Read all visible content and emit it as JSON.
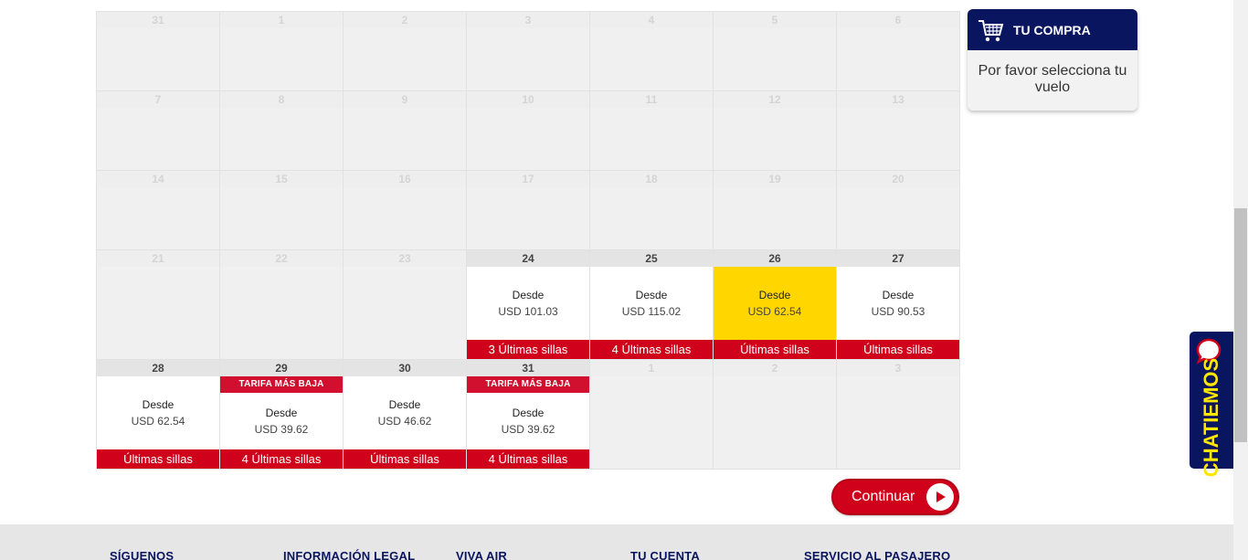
{
  "calendar": {
    "rows": [
      {
        "size": "s",
        "cells": [
          {
            "day": "31",
            "active": false
          },
          {
            "day": "1",
            "active": false
          },
          {
            "day": "2",
            "active": false
          },
          {
            "day": "3",
            "active": false
          },
          {
            "day": "4",
            "active": false
          },
          {
            "day": "5",
            "active": false
          },
          {
            "day": "6",
            "active": false
          }
        ]
      },
      {
        "size": "s",
        "cells": [
          {
            "day": "7",
            "active": false
          },
          {
            "day": "8",
            "active": false
          },
          {
            "day": "9",
            "active": false
          },
          {
            "day": "10",
            "active": false
          },
          {
            "day": "11",
            "active": false
          },
          {
            "day": "12",
            "active": false
          },
          {
            "day": "13",
            "active": false
          }
        ]
      },
      {
        "size": "s",
        "cells": [
          {
            "day": "14",
            "active": false
          },
          {
            "day": "15",
            "active": false
          },
          {
            "day": "16",
            "active": false
          },
          {
            "day": "17",
            "active": false
          },
          {
            "day": "18",
            "active": false
          },
          {
            "day": "19",
            "active": false
          },
          {
            "day": "20",
            "active": false
          }
        ]
      },
      {
        "size": "l",
        "cells": [
          {
            "day": "21",
            "active": false
          },
          {
            "day": "22",
            "active": false
          },
          {
            "day": "23",
            "active": false
          },
          {
            "day": "24",
            "active": true,
            "desde": "Desde",
            "price": "USD 101.03",
            "seats": "3 Últimas sillas"
          },
          {
            "day": "25",
            "active": true,
            "desde": "Desde",
            "price": "USD 115.02",
            "seats": "4 Últimas sillas"
          },
          {
            "day": "26",
            "active": true,
            "selected": true,
            "desde": "Desde",
            "price": "USD 62.54",
            "seats": "Últimas sillas"
          },
          {
            "day": "27",
            "active": true,
            "desde": "Desde",
            "price": "USD 90.53",
            "seats": "Últimas sillas"
          }
        ]
      },
      {
        "size": "l",
        "cells": [
          {
            "day": "28",
            "active": true,
            "desde": "Desde",
            "price": "USD 62.54",
            "seats": "Últimas sillas"
          },
          {
            "day": "29",
            "active": true,
            "badge": "TARIFA MÁS BAJA",
            "desde": "Desde",
            "price": "USD 39.62",
            "seats": "4 Últimas sillas"
          },
          {
            "day": "30",
            "active": true,
            "desde": "Desde",
            "price": "USD 46.62",
            "seats": "Últimas sillas"
          },
          {
            "day": "31",
            "active": true,
            "badge": "TARIFA MÁS BAJA",
            "desde": "Desde",
            "price": "USD 39.62",
            "seats": "4 Últimas sillas"
          },
          {
            "day": "1",
            "active": false
          },
          {
            "day": "2",
            "active": false
          },
          {
            "day": "3",
            "active": false
          }
        ]
      }
    ]
  },
  "continue_button": {
    "label": "Continuar"
  },
  "cart": {
    "title": "TU COMPRA",
    "message": "Por favor selecciona tu vuelo",
    "icon": "shopping-cart-icon"
  },
  "chat": {
    "label": "CHATIEMOS",
    "icon": "chat-bubble-icon"
  },
  "footer": {
    "columns": [
      "SÍGUENOS",
      "INFORMACIÓN LEGAL",
      "VIVA AIR",
      "TU CUENTA",
      "SERVICIO AL PASAJERO"
    ]
  },
  "colors": {
    "brand_red": "#d0021b",
    "brand_navy": "#0a1560",
    "selected_yellow": "#ffd600",
    "chat_yellow": "#ffe600"
  }
}
